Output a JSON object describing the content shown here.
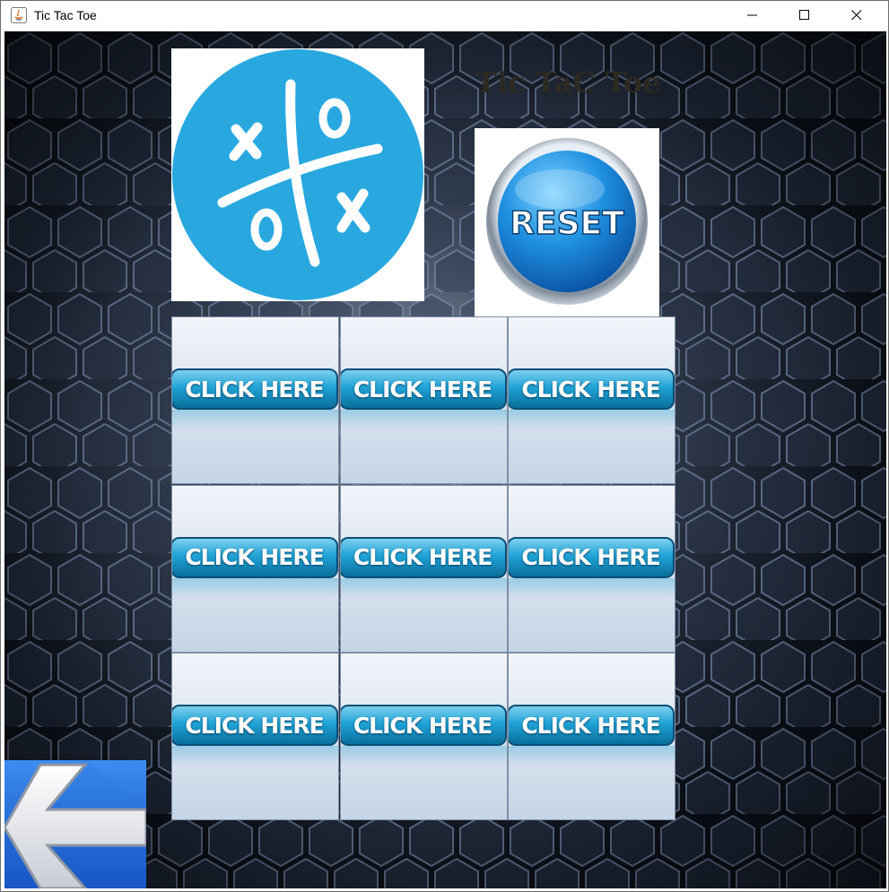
{
  "window": {
    "title": "Tic Tac Toe",
    "controls": [
      "minimize-icon",
      "maximize-icon",
      "close-icon"
    ]
  },
  "header": {
    "game_title": "Tic TaC Toe"
  },
  "logo": {
    "icon": "tic-tac-toe-logo-icon",
    "color": "#29a8e0"
  },
  "reset_button": {
    "label": "RESET",
    "color": "#1e8fe0"
  },
  "board": {
    "cells": [
      {
        "label": "CLICK HERE"
      },
      {
        "label": "CLICK HERE"
      },
      {
        "label": "CLICK HERE"
      },
      {
        "label": "CLICK HERE"
      },
      {
        "label": "CLICK HERE"
      },
      {
        "label": "CLICK HERE"
      },
      {
        "label": "CLICK HERE"
      },
      {
        "label": "CLICK HERE"
      },
      {
        "label": "CLICK HERE"
      }
    ]
  },
  "back_button": {
    "icon": "back-arrow-icon",
    "color": "#1a5fd0"
  }
}
